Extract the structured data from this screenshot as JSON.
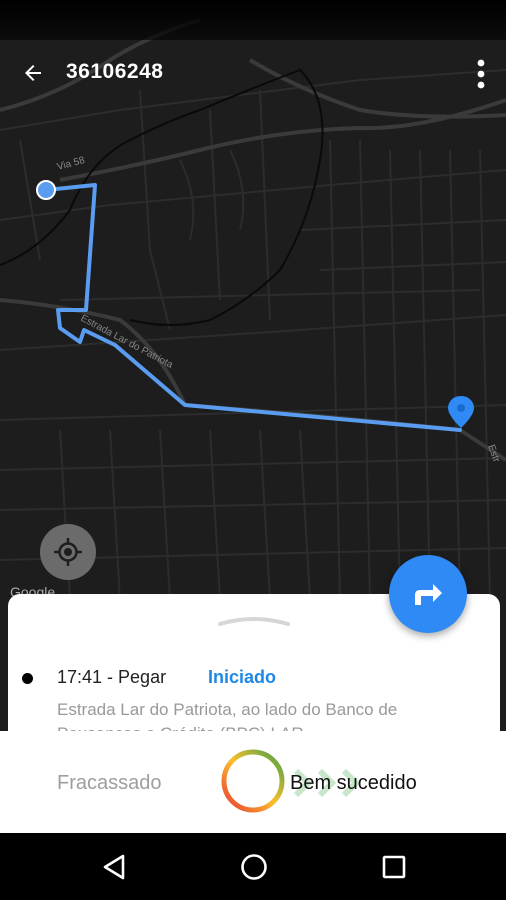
{
  "app_bar": {
    "title": "36106248"
  },
  "map": {
    "street_labels": [
      "Via 58",
      "Estrada Lar do Patriota",
      "Estr"
    ],
    "attribution": "Google",
    "route_color": "#5a9df0",
    "destination_color": "#2f8af5"
  },
  "task": {
    "time_action": "17:41 - Pegar",
    "status": "Iniciado",
    "address": "Estrada Lar do Patriota, ao lado do Banco de Pousanças e Crédito (BPC) LAR"
  },
  "actions": {
    "fail_label": "Fracassado",
    "success_label": "Bem sucedido"
  },
  "icons": {
    "back": "arrow-left-icon",
    "more": "more-vertical-icon",
    "locate": "gps-crosshair-icon",
    "navigate": "turn-right-arrow-icon",
    "nav_back": "triangle-back-icon",
    "nav_home": "circle-home-icon",
    "nav_recents": "square-recents-icon"
  }
}
